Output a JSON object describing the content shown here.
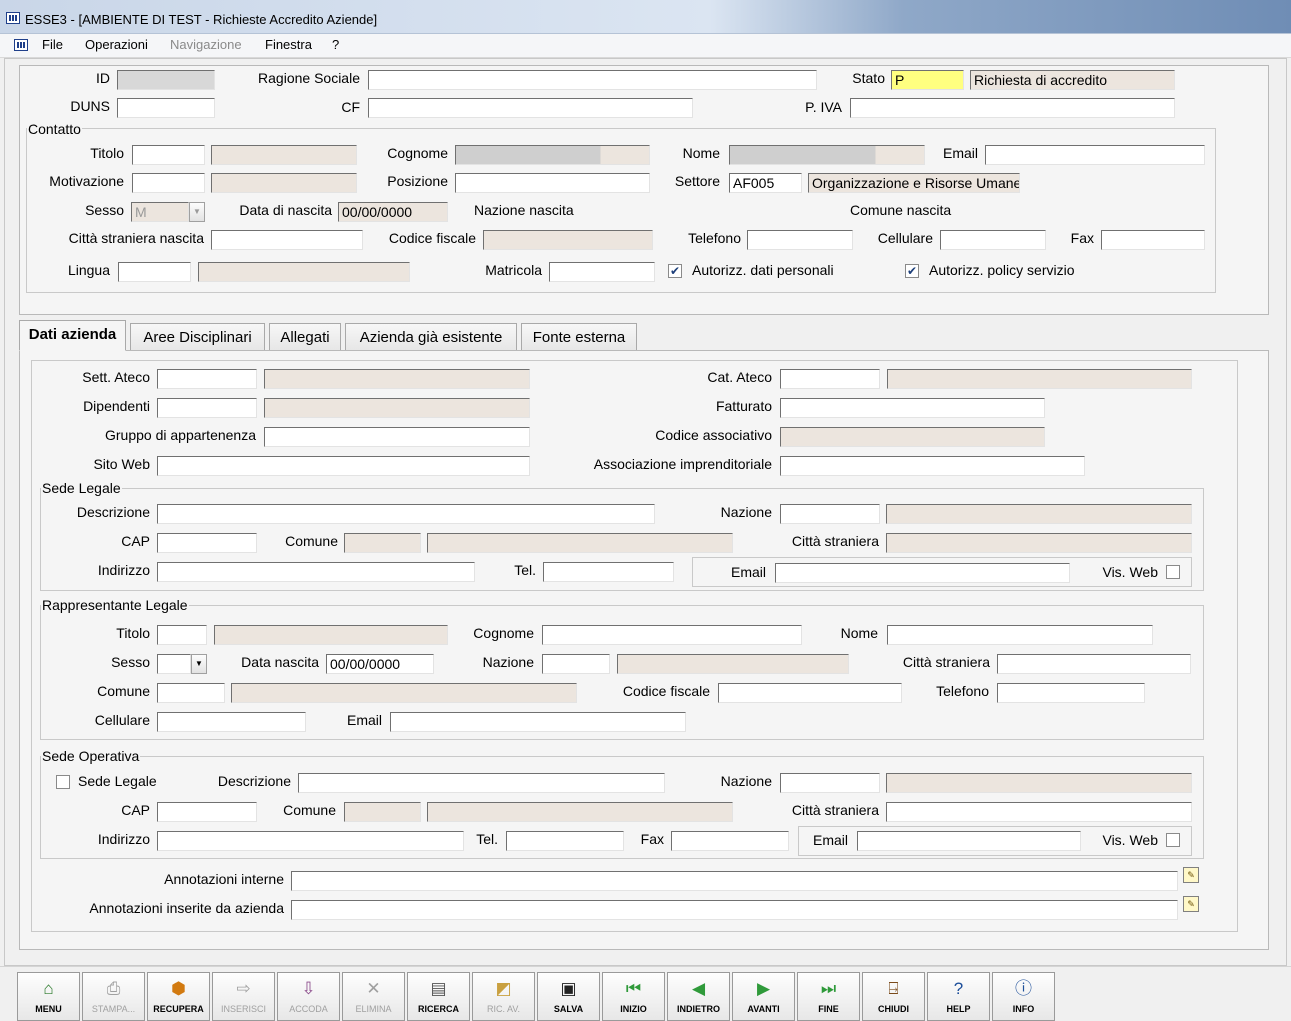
{
  "window": {
    "title": "ESSE3 - [AMBIENTE DI TEST - Richieste Accredito Aziende]"
  },
  "menu": {
    "file": "File",
    "operazioni": "Operazioni",
    "navigazione": "Navigazione",
    "finestra": "Finestra",
    "help": "?"
  },
  "header": {
    "id_label": "ID",
    "ragione_sociale_label": "Ragione Sociale",
    "stato_label": "Stato",
    "stato_code": "P",
    "stato_desc": "Richiesta di accredito",
    "duns_label": "DUNS",
    "cf_label": "CF",
    "piva_label": "P. IVA"
  },
  "contatto": {
    "legend": "Contatto",
    "titolo_label": "Titolo",
    "cognome_label": "Cognome",
    "nome_label": "Nome",
    "email_label": "Email",
    "motivazione_label": "Motivazione",
    "posizione_label": "Posizione",
    "settore_label": "Settore",
    "settore_code": "AF005",
    "settore_desc": "Organizzazione e Risorse Umane",
    "sesso_label": "Sesso",
    "sesso_value": "M",
    "data_nascita_label": "Data di nascita",
    "data_nascita_value": "00/00/0000",
    "nazione_nascita_label": "Nazione nascita",
    "comune_nascita_label": "Comune nascita",
    "citta_straniera_label": "Città straniera nascita",
    "codice_fiscale_label": "Codice fiscale",
    "telefono_label": "Telefono",
    "cellulare_label": "Cellulare",
    "fax_label": "Fax",
    "lingua_label": "Lingua",
    "matricola_label": "Matricola",
    "autorizz_dati": "Autorizz. dati personali",
    "autorizz_policy": "Autorizz. policy servizio"
  },
  "tabs": [
    "Dati azienda",
    "Aree Disciplinari",
    "Allegati",
    "Azienda già esistente",
    "Fonte esterna"
  ],
  "dati_azienda": {
    "sett_ateco": "Sett. Ateco",
    "cat_ateco": "Cat. Ateco",
    "dipendenti": "Dipendenti",
    "fatturato": "Fatturato",
    "gruppo": "Gruppo di appartenenza",
    "codice_associativo": "Codice associativo",
    "sito_web": "Sito Web",
    "associazione": "Associazione imprenditoriale"
  },
  "sede_legale": {
    "legend": "Sede Legale",
    "descrizione": "Descrizione",
    "nazione": "Nazione",
    "cap": "CAP",
    "comune": "Comune",
    "citta_straniera": "Città straniera",
    "indirizzo": "Indirizzo",
    "tel": "Tel.",
    "email": "Email",
    "vis_web": "Vis. Web"
  },
  "rappresentante": {
    "legend": "Rappresentante Legale",
    "titolo": "Titolo",
    "cognome": "Cognome",
    "nome": "Nome",
    "sesso": "Sesso",
    "data_nascita": "Data nascita",
    "data_nascita_value": "00/00/0000",
    "nazione": "Nazione",
    "citta_straniera": "Città straniera",
    "comune": "Comune",
    "codice_fiscale": "Codice fiscale",
    "telefono": "Telefono",
    "cellulare": "Cellulare",
    "email": "Email"
  },
  "sede_operativa": {
    "legend": "Sede Operativa",
    "sede_legale_cb": "Sede Legale",
    "descrizione": "Descrizione",
    "nazione": "Nazione",
    "cap": "CAP",
    "comune": "Comune",
    "citta_straniera": "Città straniera",
    "indirizzo": "Indirizzo",
    "tel": "Tel.",
    "fax": "Fax",
    "email": "Email",
    "vis_web": "Vis. Web"
  },
  "annotazioni": {
    "interne": "Annotazioni interne",
    "azienda": "Annotazioni inserite da azienda"
  },
  "toolbar": {
    "menu": "MENU",
    "stampa": "STAMPA...",
    "recupera": "RECUPERA",
    "inserisci": "INSERISCI",
    "accoda": "ACCODA",
    "elimina": "ELIMINA",
    "ricerca": "RICERCA",
    "ric_av": "RIC. AV.",
    "salva": "SALVA",
    "inizio": "INIZIO",
    "indietro": "INDIETRO",
    "avanti": "AVANTI",
    "fine": "FINE",
    "chiudi": "CHIUDI",
    "help": "HELP",
    "info": "INFO"
  }
}
